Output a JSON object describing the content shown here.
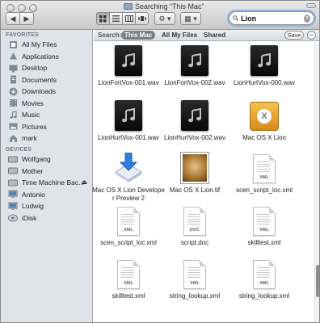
{
  "window": {
    "title": "Searching “This Mac”"
  },
  "toolbar": {
    "back_icon": "◀",
    "forward_icon": "▶",
    "action_icon": "⚙ ▾",
    "arrange_icon": "▦ ▾"
  },
  "search": {
    "value": "Lion",
    "clear_icon": "✕"
  },
  "scope_bar": {
    "label": "Search:",
    "this_mac": "This Mac",
    "all_files": "All My Files",
    "shared": "Shared",
    "save": "Save",
    "remove": "−"
  },
  "sidebar": {
    "favorites_header": "FAVORITES",
    "devices_header": "DEVICES",
    "favorites": [
      {
        "label": "All My Files",
        "icon": "all-files-icon"
      },
      {
        "label": "Applications",
        "icon": "applications-icon"
      },
      {
        "label": "Desktop",
        "icon": "desktop-icon"
      },
      {
        "label": "Documents",
        "icon": "documents-icon"
      },
      {
        "label": "Downloads",
        "icon": "downloads-icon"
      },
      {
        "label": "Movies",
        "icon": "movies-icon"
      },
      {
        "label": "Music",
        "icon": "music-icon"
      },
      {
        "label": "Pictures",
        "icon": "pictures-icon"
      },
      {
        "label": "mark",
        "icon": "home-icon"
      }
    ],
    "devices": [
      {
        "label": "Wolfgang",
        "icon": "disk-icon"
      },
      {
        "label": "Mother",
        "icon": "disk-icon"
      },
      {
        "label": "Time Machine Bac...",
        "icon": "disk-icon",
        "eject": "⏏"
      },
      {
        "label": "Antonio",
        "icon": "computer-icon"
      },
      {
        "label": "Ludwig",
        "icon": "computer-icon"
      },
      {
        "label": "iDisk",
        "icon": "idisk-icon"
      }
    ]
  },
  "files": [
    {
      "name": "LionFortVox-001.wav",
      "kind": "audio"
    },
    {
      "name": "LionFortVox-002.wav",
      "kind": "audio"
    },
    {
      "name": "LionHurtVox-000.wav",
      "kind": "audio"
    },
    {
      "name": "LionHurtVox-001.wav",
      "kind": "audio"
    },
    {
      "name": "LionHurtVox-002.wav",
      "kind": "audio"
    },
    {
      "name": "Mac OS X Lion",
      "kind": "drive"
    },
    {
      "name": "Mac OS X Lion Developer Preview 2",
      "kind": "package"
    },
    {
      "name": "Mac OS X Lion.tif",
      "kind": "image"
    },
    {
      "name": "scen_script_loc.xml",
      "kind": "xml",
      "tag": "XML"
    },
    {
      "name": "scen_script_loc.xml",
      "kind": "xml",
      "tag": "XML"
    },
    {
      "name": "script.doc",
      "kind": "doc",
      "tag": "DOC"
    },
    {
      "name": "skilltest.xml",
      "kind": "xml",
      "tag": "XML"
    },
    {
      "name": "skilltest.xml",
      "kind": "xml",
      "tag": "XML"
    },
    {
      "name": "string_lookup.xml",
      "kind": "xml",
      "tag": "XML"
    },
    {
      "name": "string_lookup.xml",
      "kind": "xml",
      "tag": "XML"
    }
  ],
  "colors": {
    "sidebar_bg": "#dee4ea",
    "scope_selected": "#7a7f86",
    "search_focus": "#8fb3e3"
  }
}
